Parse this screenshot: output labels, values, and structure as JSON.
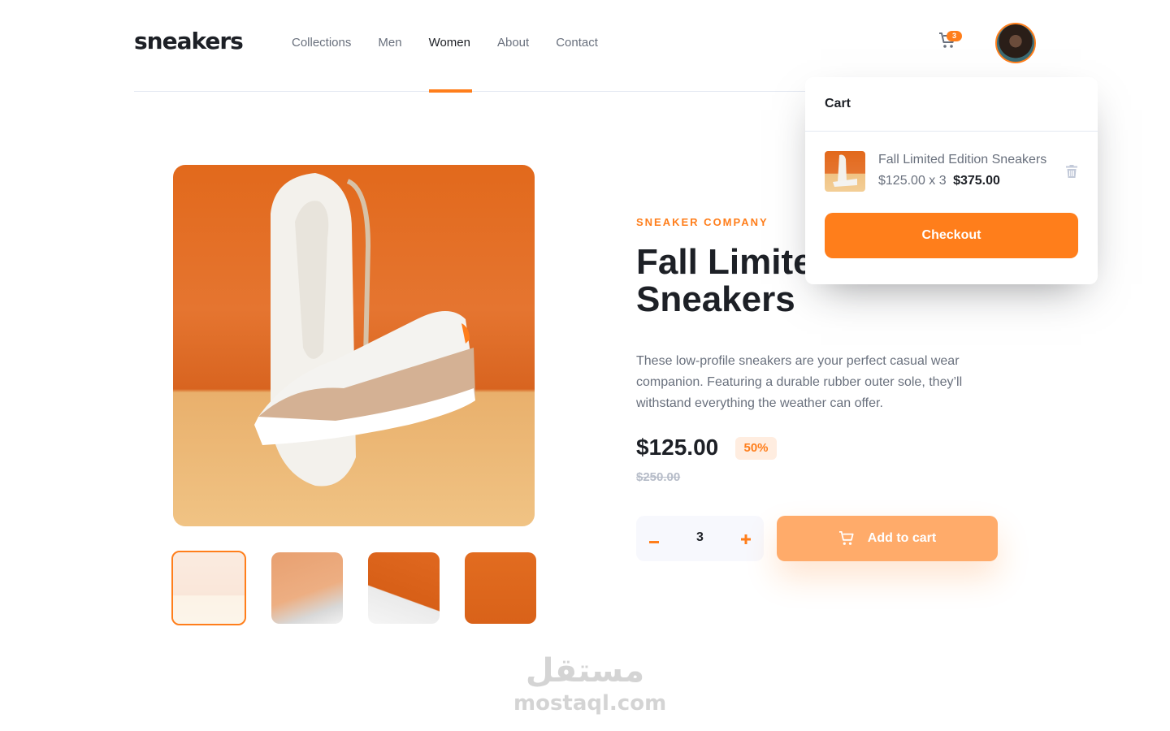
{
  "header": {
    "logo": "sneakers",
    "nav": [
      {
        "label": "Collections",
        "active": false
      },
      {
        "label": "Men",
        "active": false
      },
      {
        "label": "Women",
        "active": true
      },
      {
        "label": "About",
        "active": false
      },
      {
        "label": "Contact",
        "active": false
      }
    ],
    "cart_icon": "cart-icon",
    "cart_count": "3",
    "avatar": "user-avatar"
  },
  "gallery": {
    "main_image": "sneaker-main-photo",
    "thumbnails": [
      {
        "name": "thumbnail-1",
        "active": true
      },
      {
        "name": "thumbnail-2",
        "active": false
      },
      {
        "name": "thumbnail-3",
        "active": false
      },
      {
        "name": "thumbnail-4",
        "active": false
      }
    ]
  },
  "product": {
    "company": "SNEAKER COMPANY",
    "title": "Fall Limited Edition Sneakers",
    "description": "These low-profile sneakers are your perfect casual wear companion. Featuring a durable rubber outer sole, they’ll withstand everything the weather can offer.",
    "price": "$125.00",
    "discount": "50%",
    "original_price": "$250.00",
    "quantity": "3",
    "minus_label": "−",
    "plus_label": "+",
    "add_to_cart": "Add to cart"
  },
  "cart": {
    "title": "Cart",
    "items": [
      {
        "name": "Fall Limited Edition Sneakers",
        "unit_price": "$125.00 x 3",
        "total": "$375.00"
      }
    ],
    "checkout": "Checkout"
  },
  "watermark": {
    "arabic": "مستقل",
    "latin": "mostaql.com"
  },
  "colors": {
    "accent": "#ff7e1b",
    "accent_light": "#ffede0",
    "text_dark": "#1d2026",
    "text_gray": "#69707d",
    "muted": "#b6bcc8"
  }
}
